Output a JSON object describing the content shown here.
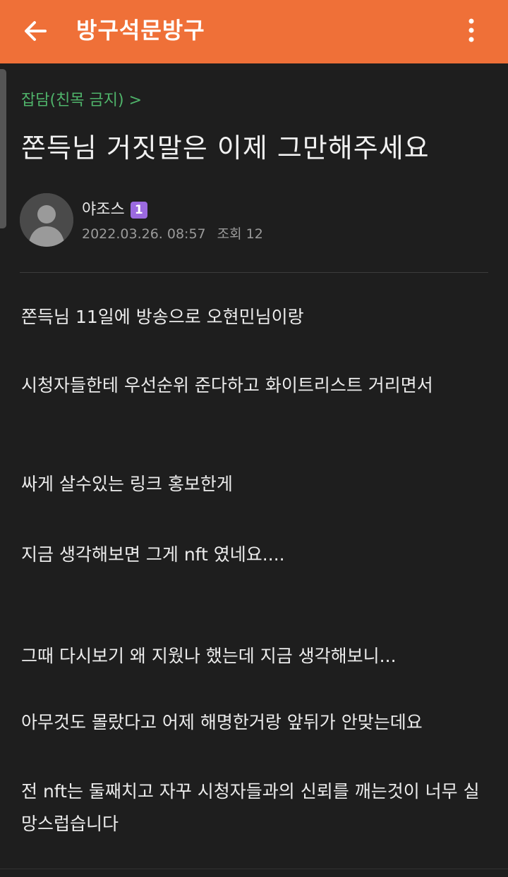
{
  "header": {
    "title": "방구석문방구",
    "back_icon": "arrow-left-icon",
    "more_icon": "more-vertical-icon",
    "bg_color": "#ef7038"
  },
  "post": {
    "category": "잡담(친목 금지) >",
    "title": "쫀득님 거짓말은 이제 그만해주세요",
    "author": "야조스",
    "level": "1",
    "date": "2022.03.26. 08:57",
    "views": "조회 12",
    "paragraphs": [
      "쫀득님 11일에 방송으로 오현민님이랑",
      "시청자들한테 우선순위 준다하고 화이트리스트 거리면서",
      "싸게 살수있는 링크 홍보한게",
      "지금 생각해보면 그게 nft 였네요....",
      "그때 다시보기 왜 지웠나 했는데 지금 생각해보니...",
      "아무것도 몰랐다고 어제 해명한거랑 앞뒤가 안맞는데요",
      "전 nft는 둘째치고 자꾸 시청자들과의 신뢰를 깨는것이 너무 실망스럽습니다"
    ]
  }
}
